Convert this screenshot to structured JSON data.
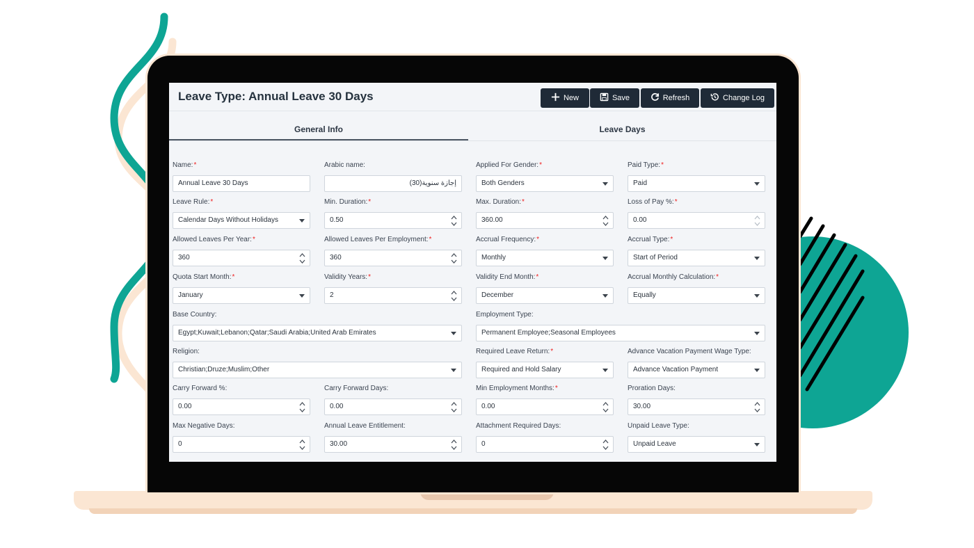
{
  "colors": {
    "teal": "#0ea594",
    "peach": "#fbe6d3",
    "toolbar_button": "#1f2a37",
    "required_star": "#e22222"
  },
  "header": {
    "title": "Leave Type: Annual Leave 30 Days",
    "buttons": [
      {
        "label": "New",
        "icon": "plus-icon"
      },
      {
        "label": "Save",
        "icon": "floppy-disk-icon"
      },
      {
        "label": "Refresh",
        "icon": "refresh-icon"
      },
      {
        "label": "Change Log",
        "icon": "history-icon"
      }
    ]
  },
  "tabs": [
    {
      "label": "General Info",
      "active": true
    },
    {
      "label": "Leave Days",
      "active": false
    }
  ],
  "form": {
    "name": {
      "label": "Name:",
      "value": "Annual Leave 30 Days"
    },
    "arabic_name": {
      "label": "Arabic name:",
      "value": "إجازة سنوية(30)"
    },
    "applied_gender": {
      "label": "Applied For Gender:",
      "value": "Both Genders"
    },
    "paid_type": {
      "label": "Paid Type:",
      "value": "Paid"
    },
    "leave_rule": {
      "label": "Leave Rule:",
      "value": "Calendar Days Without Holidays"
    },
    "min_duration": {
      "label": "Min. Duration:",
      "value": "0.50"
    },
    "max_duration": {
      "label": "Max. Duration:",
      "value": "360.00"
    },
    "loss_of_pay": {
      "label": "Loss of Pay %:",
      "value": "0.00"
    },
    "allowed_per_year": {
      "label": "Allowed Leaves Per Year:",
      "value": "360"
    },
    "allowed_per_employment": {
      "label": "Allowed Leaves Per Employment:",
      "value": "360"
    },
    "accrual_frequency": {
      "label": "Accrual Frequency:",
      "value": "Monthly"
    },
    "accrual_type": {
      "label": "Accrual Type:",
      "value": "Start of Period"
    },
    "quota_start_month": {
      "label": "Quota Start Month:",
      "value": "January"
    },
    "validity_years": {
      "label": "Validity Years:",
      "value": "2"
    },
    "validity_end_month": {
      "label": "Validity End Month:",
      "value": "December"
    },
    "accrual_monthly_calc": {
      "label": "Accrual Monthly Calculation:",
      "value": "Equally"
    },
    "base_country": {
      "label": "Base Country:",
      "value": "Egypt;Kuwait;Lebanon;Qatar;Saudi Arabia;United Arab Emirates"
    },
    "employment_type": {
      "label": "Employment Type:",
      "value": "Permanent Employee;Seasonal Employees"
    },
    "religion": {
      "label": "Religion:",
      "value": "Christian;Druze;Muslim;Other"
    },
    "required_leave_return": {
      "label": "Required Leave Return:",
      "value": "Required and Hold Salary"
    },
    "advance_vacation_wage": {
      "label": "Advance Vacation Payment Wage Type:",
      "value": "Advance Vacation Payment"
    },
    "carry_forward_pct": {
      "label": "Carry Forward %:",
      "value": "0.00"
    },
    "carry_forward_days": {
      "label": "Carry Forward Days:",
      "value": "0.00"
    },
    "min_employment_months": {
      "label": "Min Employment Months:",
      "value": "0.00"
    },
    "proration_days": {
      "label": "Proration Days:",
      "value": "30.00"
    },
    "max_negative_days": {
      "label": "Max Negative Days:",
      "value": "0"
    },
    "annual_entitlement": {
      "label": "Annual Leave Entitlement:",
      "value": "30.00"
    },
    "attachment_days": {
      "label": "Attachment Required Days:",
      "value": "0"
    },
    "unpaid_leave_type": {
      "label": "Unpaid Leave Type:",
      "value": "Unpaid Leave"
    }
  }
}
